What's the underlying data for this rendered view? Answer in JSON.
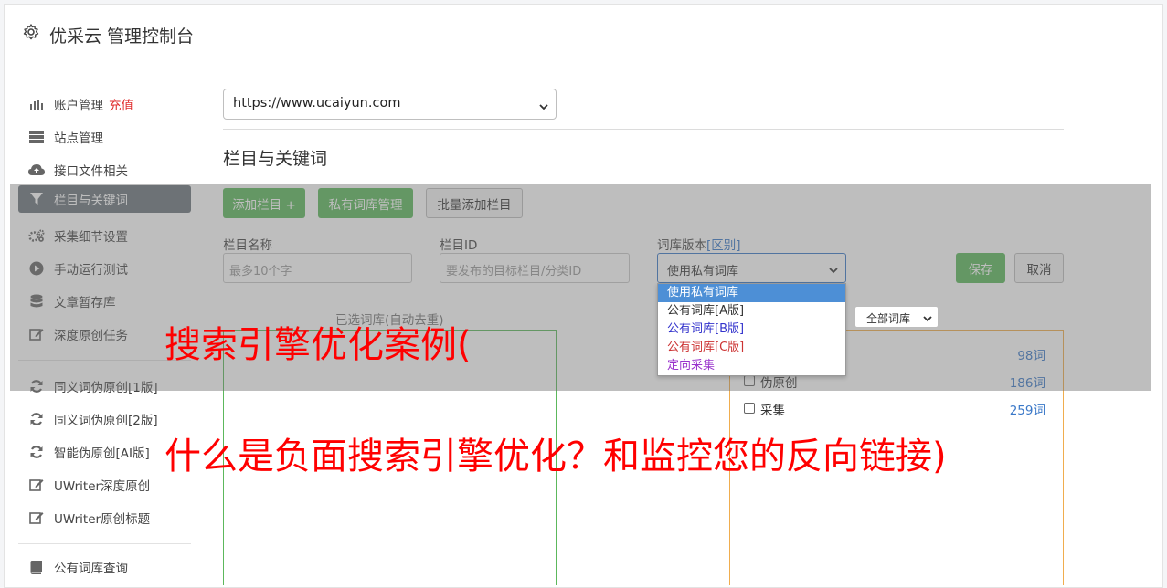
{
  "app": {
    "title": "优采云 管理控制台"
  },
  "sidebar": {
    "items": [
      {
        "label": "账户管理",
        "extra": "充值",
        "icon": "bar-chart-icon"
      },
      {
        "label": "站点管理",
        "icon": "server-icon"
      },
      {
        "label": "接口文件相关",
        "icon": "cloud-upload-icon"
      },
      {
        "label": "栏目与关键词",
        "icon": "filter-icon",
        "active": true
      },
      {
        "label": "采集细节设置",
        "icon": "cogs-icon"
      },
      {
        "label": "手动运行测试",
        "icon": "play-circle-icon"
      },
      {
        "label": "文章暂存库",
        "icon": "database-icon"
      },
      {
        "label": "深度原创任务",
        "icon": "edit-icon"
      },
      {
        "label": "同义词伪原创[1版]",
        "icon": "refresh-icon"
      },
      {
        "label": "同义词伪原创[2版]",
        "icon": "refresh-icon"
      },
      {
        "label": "智能伪原创[AI版]",
        "icon": "refresh-icon"
      },
      {
        "label": "UWriter深度原创",
        "icon": "edit-icon"
      },
      {
        "label": "UWriter原创标题",
        "icon": "edit-icon"
      },
      {
        "label": "公有词库查询",
        "icon": "book-icon"
      }
    ]
  },
  "site_select": {
    "value": "https://www.ucaiyun.com"
  },
  "section": {
    "title": "栏目与关键词"
  },
  "toolbar": {
    "add_column": "添加栏目 +",
    "private_lib": "私有词库管理",
    "batch_add": "批量添加栏目"
  },
  "form": {
    "column_name_label": "栏目名称",
    "column_name_placeholder": "最多10个字",
    "column_id_label": "栏目ID",
    "column_id_placeholder": "要发布的目标栏目/分类ID",
    "version_label": "词库版本",
    "version_link": "[区别]",
    "version_value": "使用私有词库",
    "save": "保存",
    "cancel": "取消"
  },
  "version_options": [
    {
      "label": "使用私有词库",
      "color": "#ffffff",
      "selected": true
    },
    {
      "label": "公有词库[A版]",
      "color": "#333333"
    },
    {
      "label": "公有词库[B版]",
      "color": "#3333cc"
    },
    {
      "label": "公有词库[C版]",
      "color": "#cc3333"
    },
    {
      "label": "定向采集",
      "color": "#9933cc"
    }
  ],
  "selected_panel": {
    "caption": "已选词库(自动去重)"
  },
  "library_filter": {
    "value": "全部词库"
  },
  "libraries": [
    {
      "name": "",
      "count": "98词"
    },
    {
      "name": "伪原创",
      "count": "186词"
    },
    {
      "name": "采集",
      "count": "259词"
    }
  ],
  "watermark": {
    "line1": "搜索引擎优化案例(",
    "line2": "什么是负面搜索引擎优化？和监控您的反向链接)"
  },
  "colors": {
    "accent_green": "#5cb85c",
    "accent_blue": "#3a78c8",
    "warning_orange": "#f0ad4e",
    "watermark_red": "#ff0000"
  }
}
